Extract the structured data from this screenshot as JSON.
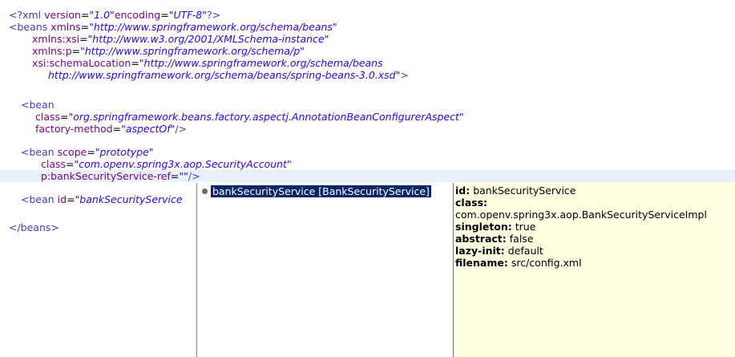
{
  "xml": {
    "decl_open": "<?xml ",
    "decl_version_attr": "version",
    "decl_version_val": "\"1.0\"",
    "decl_encoding_attr": "encoding",
    "decl_encoding_val": "\"UTF-8\"",
    "decl_close": "?>",
    "beans_open": "<beans ",
    "xmlns_attr": "xmlns",
    "xmlns_val": "\"http://www.springframework.org/schema/beans\"",
    "xmlns_xsi_attr": "xmlns:xsi",
    "xmlns_xsi_val": "\"http://www.w3.org/2001/XMLSchema-instance\"",
    "xmlns_p_attr": "xmlns:p",
    "xmlns_p_val": "\"http://www.springframework.org/schema/p\"",
    "schema_loc_attr": "xsi:schemaLocation",
    "schema_loc_val1": "\"http://www.springframework.org/schema/beans",
    "schema_loc_val2": "http://www.springframework.org/schema/beans/spring-beans-3.0.xsd\"",
    "gt": ">",
    "bean1_open": "<bean",
    "class_attr": "class",
    "bean1_class_val": "\"org.springframework.beans.factory.aspectj.AnnotationBeanConfigurerAspect\"",
    "factory_attr": "factory-method",
    "factory_val": "\"aspectOf\"",
    "close_slash": "/>",
    "bean2_open": "<bean ",
    "scope_attr": "scope",
    "scope_val": "\"prototype\"",
    "bean2_class_val": "\"com.openv.spring3x.aop.SecurityAccount\"",
    "pref_attr": "p:bankSecurityService-ref",
    "pref_val": "\"\"",
    "bean3_open": "<bean ",
    "id_attr": "id",
    "bean3_id_val": "\"bankSecurityService",
    "beans_close": "</beans>",
    "equals": "="
  },
  "assist": {
    "proposal": "bankSecurityService [BankSecurityService]"
  },
  "info": {
    "id_key": "id:",
    "id_val": " bankSecurityService",
    "class_key": "class:",
    "class_val": " com.openv.spring3x.aop.BankSecurityServiceImpl",
    "singleton_key": "singleton:",
    "singleton_val": " true",
    "abstract_key": "abstract:",
    "abstract_val": " false",
    "lazy_key": "lazy-init:",
    "lazy_val": " default",
    "filename_key": "filename:",
    "filename_val": " src/config.xml"
  }
}
